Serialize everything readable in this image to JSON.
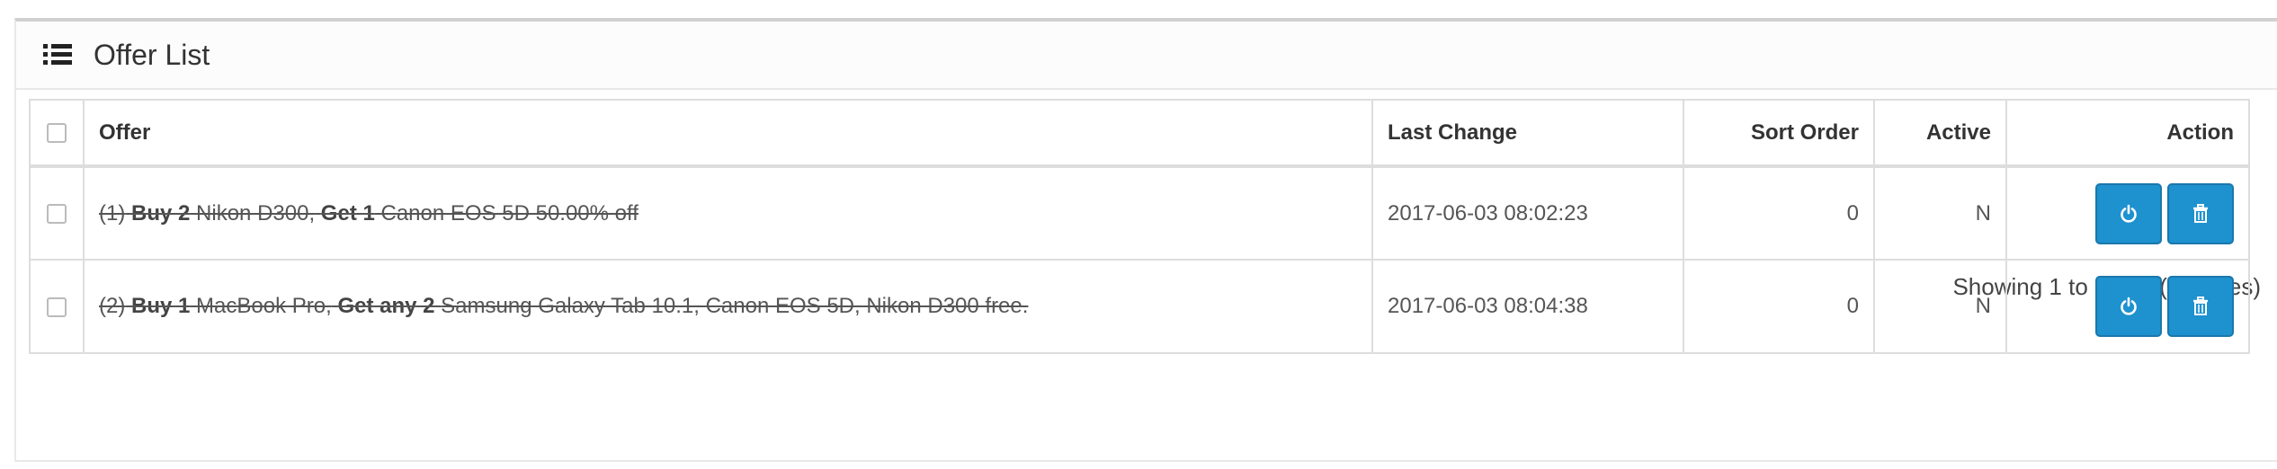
{
  "panel": {
    "title": "Offer List",
    "icon": "list-icon"
  },
  "table": {
    "headers": {
      "offer": "Offer",
      "last_change": "Last Change",
      "sort_order": "Sort Order",
      "active": "Active",
      "action": "Action"
    },
    "rows": [
      {
        "num": "(1)",
        "buy_label": "Buy 2",
        "buy_item": "Nikon D300,",
        "get_label": "Get 1",
        "get_item": "Canon EOS 5D 50.00% off",
        "last_change": "2017-06-03 08:02:23",
        "sort_order": "0",
        "active": "N"
      },
      {
        "num": "(2)",
        "buy_label": "Buy 1",
        "buy_item": "MacBook Pro,",
        "get_label": "Get any 2",
        "get_item": "Samsung Galaxy Tab 10.1, Canon EOS 5D, Nikon D300 free.",
        "last_change": "2017-06-03 08:04:38",
        "sort_order": "0",
        "active": "N"
      }
    ],
    "action_icons": [
      "power-icon",
      "trash-icon"
    ]
  },
  "pagination": {
    "text": "Showing 1 to 2 of 2 (1 Pages)"
  },
  "colors": {
    "accent": "#1e91cf",
    "border": "#dddddd"
  }
}
